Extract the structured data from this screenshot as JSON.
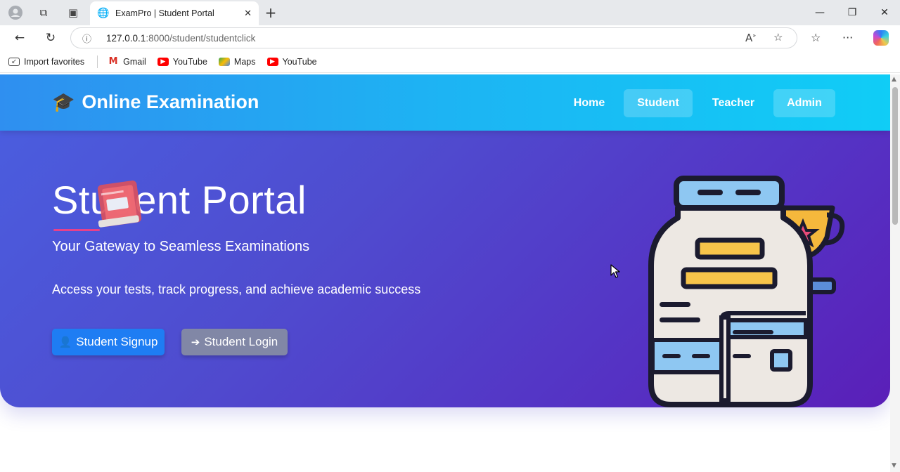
{
  "browser": {
    "tab_title": "ExamPro | Student Portal",
    "url_host": "127.0.0.1",
    "url_path": ":8000/student/studentclick",
    "bookmarks": [
      {
        "label": "Import favorites",
        "icon": "import-icon"
      },
      {
        "label": "Gmail",
        "icon": "gmail-icon",
        "color": "#d93025"
      },
      {
        "label": "YouTube",
        "icon": "youtube-icon",
        "color": "#ff0000"
      },
      {
        "label": "Maps",
        "icon": "maps-icon",
        "color": "#34a853"
      },
      {
        "label": "YouTube",
        "icon": "youtube-icon",
        "color": "#ff0000"
      }
    ]
  },
  "navbar": {
    "brand": "Online Examination",
    "brand_icon": "graduation-cap-icon",
    "links": [
      {
        "label": "Home",
        "active": false
      },
      {
        "label": "Student",
        "active": true
      },
      {
        "label": "Teacher",
        "active": false
      },
      {
        "label": "Admin",
        "active": true
      }
    ]
  },
  "hero": {
    "title": "Student Portal",
    "subtitle": "Your Gateway to Seamless Examinations",
    "tagline": "Access your tests, track progress, and achieve academic success",
    "signup_label": "Student Signup",
    "login_label": "Student Login"
  },
  "colors": {
    "navbar_start": "#2f8ff0",
    "navbar_end": "#10cdf6",
    "hero_start": "#4a5fe0",
    "hero_end": "#5a1fb8",
    "signup_button": "#1e7df3",
    "login_button": "#8187a6",
    "underline": "#e8418a"
  }
}
